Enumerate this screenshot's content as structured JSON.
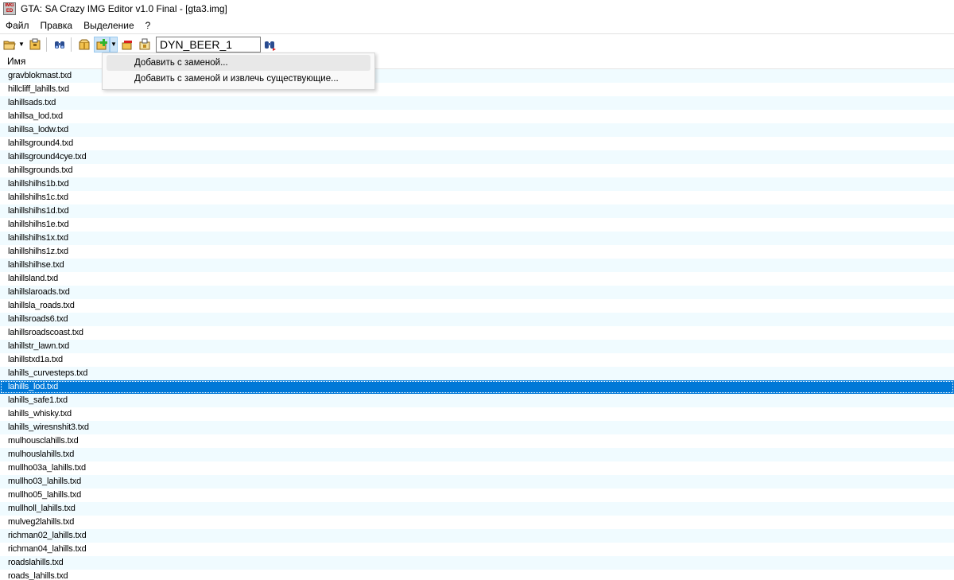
{
  "window": {
    "title": "GTA: SA Crazy IMG Editor v1.0 Final - [gta3.img]",
    "icon_text_top": "IMG",
    "icon_text_bottom": "ED"
  },
  "menu": [
    "Файл",
    "Правка",
    "Выделение",
    "?"
  ],
  "toolbar": {
    "icons": [
      "open-folder-icon",
      "dropdown-arrow",
      "archive-icon",
      "binoculars-icon",
      "box-icon",
      "add-icon",
      "dropdown-arrow",
      "remove-icon",
      "extract-icon",
      "find-next-icon"
    ],
    "search_value": "DYN_BEER_1"
  },
  "list": {
    "column_header": "Имя",
    "selected_index": 23,
    "items": [
      "gravblokmast.txd",
      "hillcliff_lahills.txd",
      "lahillsads.txd",
      "lahillsa_lod.txd",
      "lahillsa_lodw.txd",
      "lahillsground4.txd",
      "lahillsground4cye.txd",
      "lahillsgrounds.txd",
      "lahillshilhs1b.txd",
      "lahillshilhs1c.txd",
      "lahillshilhs1d.txd",
      "lahillshilhs1e.txd",
      "lahillshilhs1x.txd",
      "lahillshilhs1z.txd",
      "lahillshilhse.txd",
      "lahillsland.txd",
      "lahillslaroads.txd",
      "lahillsla_roads.txd",
      "lahillsroads6.txd",
      "lahillsroadscoast.txd",
      "lahillstr_lawn.txd",
      "lahillstxd1a.txd",
      "lahills_curvesteps.txd",
      "lahills_lod.txd",
      "lahills_safe1.txd",
      "lahills_whisky.txd",
      "lahills_wiresnshit3.txd",
      "mulhousclahills.txd",
      "mulhouslahills.txd",
      "mullho03a_lahills.txd",
      "mullho03_lahills.txd",
      "mullho05_lahills.txd",
      "mullholl_lahills.txd",
      "mulveg2lahills.txd",
      "richman02_lahills.txd",
      "richman04_lahills.txd",
      "roadslahills.txd",
      "roads_lahills.txd"
    ]
  },
  "dropdown": {
    "items": [
      "Добавить с заменой...",
      "Добавить с заменой и извлечь существующие..."
    ]
  }
}
